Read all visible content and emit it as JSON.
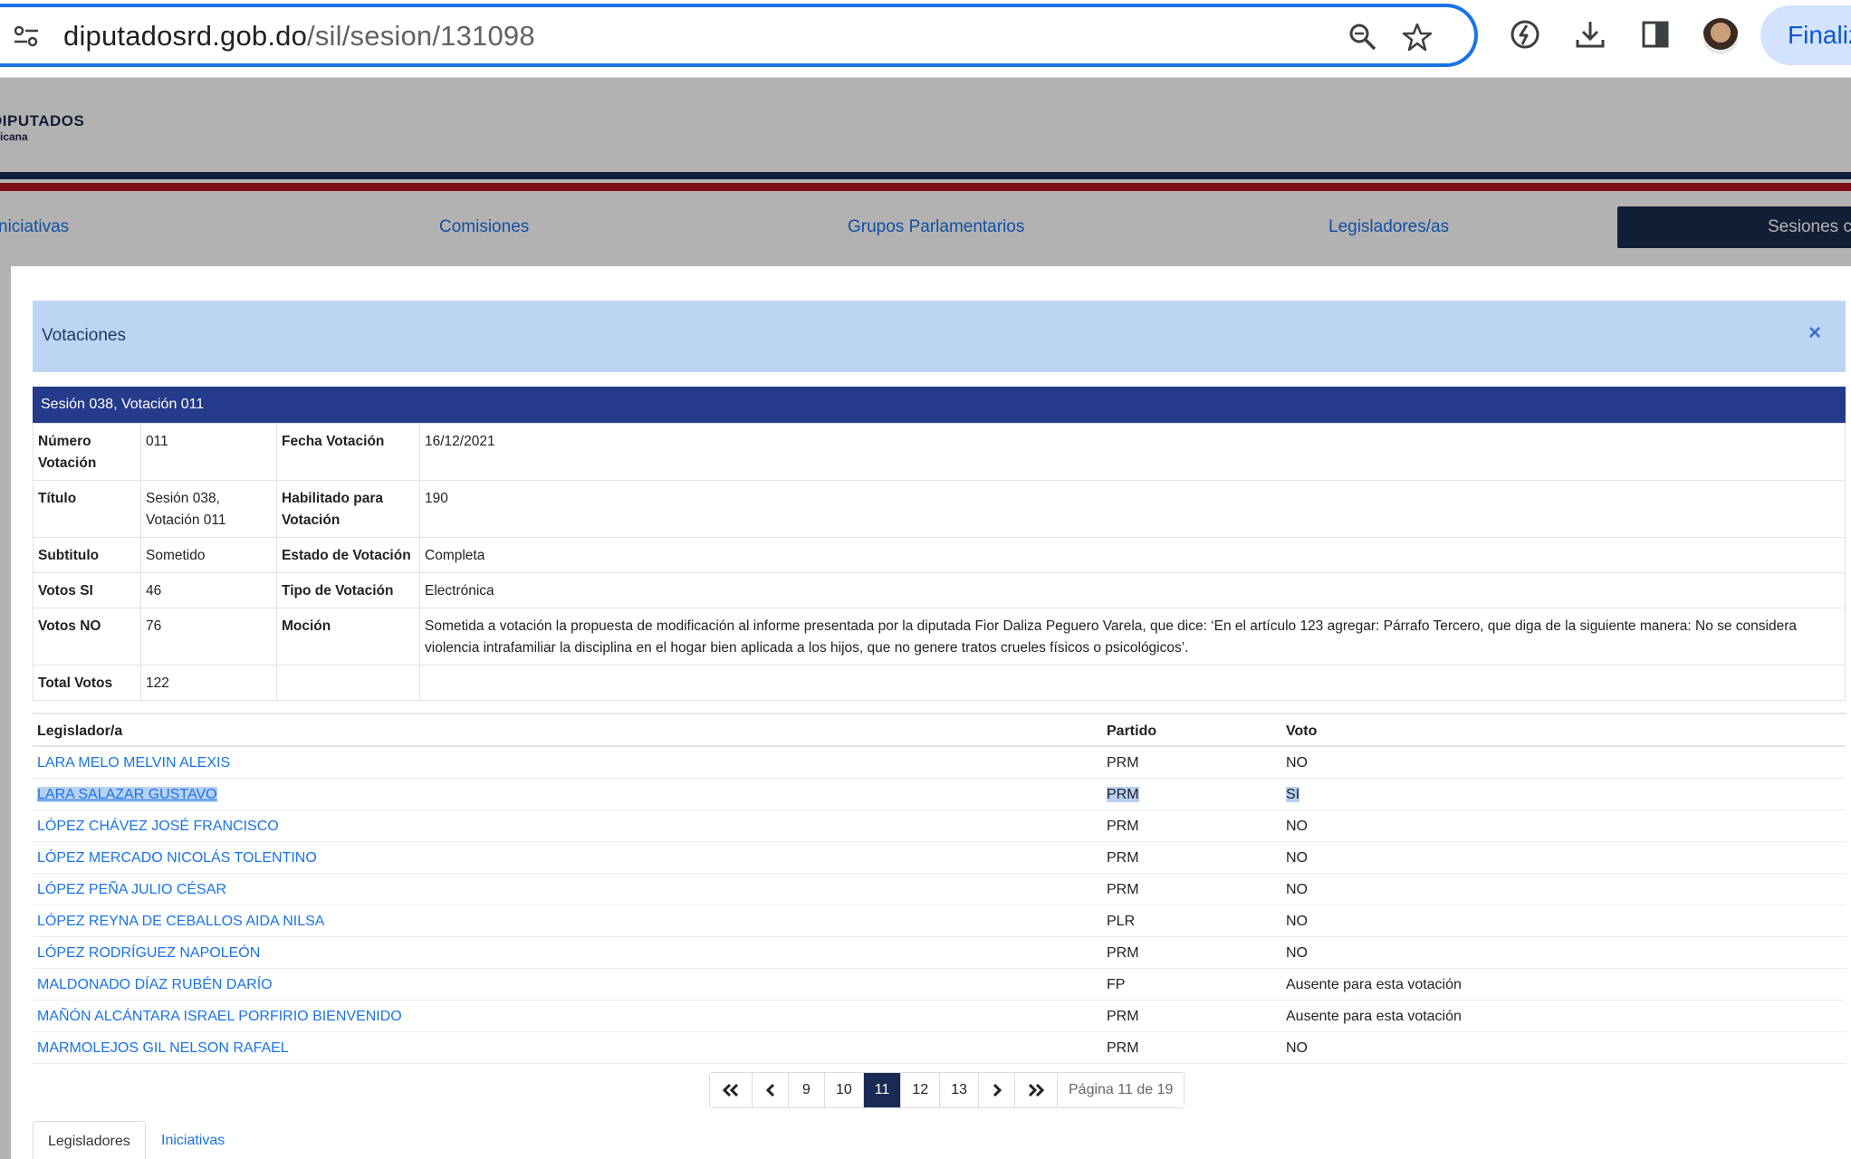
{
  "browser": {
    "url_host": "diputadosrd.gob.do",
    "url_path": "/sil/sesion/131098",
    "finalize_label": "Finaliz"
  },
  "site": {
    "logo_text": "DIPUTADOS",
    "logo_sub": "icana",
    "nav": [
      "niciativas",
      "Comisiones",
      "Grupos Parlamentarios",
      "Legisladores/as"
    ],
    "nav_active": "Sesiones c"
  },
  "modal": {
    "title": "Votaciones",
    "close": "×",
    "detail_header": "Sesión 038, Votación 011",
    "fields": {
      "numero_label": "Número Votación",
      "numero": "011",
      "fecha_label": "Fecha Votación",
      "fecha": "16/12/2021",
      "titulo_label": "Título",
      "titulo": "Sesión 038, Votación 011",
      "habilitado_label": "Habilitado para Votación",
      "habilitado": "190",
      "subtitulo_label": "Subtitulo",
      "subtitulo": "Sometido",
      "estado_label": "Estado de Votación",
      "estado": "Completa",
      "si_label": "Votos SI",
      "si": "46",
      "tipo_label": "Tipo de Votación",
      "tipo": "Electrónica",
      "no_label": "Votos NO",
      "no": "76",
      "mocion_label": "Moción",
      "mocion": "Sometida a votación la propuesta de modificación al informe presentada por la diputada Fior Daliza Peguero Varela, que dice: ‘En el artículo 123 agregar: Párrafo Tercero, que diga de la siguiente manera: No se considera violencia intrafamiliar la disciplina en el hogar bien aplicada a los hijos, que no genere tratos crueles físicos o psicológicos’.",
      "total_label": "Total Votos",
      "total": "122"
    },
    "votes_columns": [
      "Legislador/a",
      "Partido",
      "Voto"
    ],
    "votes": [
      {
        "name": "LARA MELO MELVIN ALEXIS",
        "party": "PRM",
        "vote": "NO"
      },
      {
        "name": "LARA SALAZAR GUSTAVO",
        "party": "PRM",
        "vote": "SI",
        "highlighted": true
      },
      {
        "name": "LÓPEZ CHÁVEZ JOSÉ FRANCISCO",
        "party": "PRM",
        "vote": "NO"
      },
      {
        "name": "LÓPEZ MERCADO NICOLÁS TOLENTINO",
        "party": "PRM",
        "vote": "NO"
      },
      {
        "name": "LÓPEZ PEÑA JULIO CÉSAR",
        "party": "PRM",
        "vote": "NO"
      },
      {
        "name": "LÓPEZ REYNA DE CEBALLOS AIDA NILSA",
        "party": "PLR",
        "vote": "NO"
      },
      {
        "name": "LÓPEZ RODRÍGUEZ NAPOLEÓN",
        "party": "PRM",
        "vote": "NO"
      },
      {
        "name": "MALDONADO DÍAZ RUBÉN DARÍO",
        "party": "FP",
        "vote": "Ausente para esta votación"
      },
      {
        "name": "MAÑÓN ALCÁNTARA ISRAEL PORFIRIO BIENVENIDO",
        "party": "PRM",
        "vote": "Ausente para esta votación"
      },
      {
        "name": "MARMOLEJOS GIL NELSON RAFAEL",
        "party": "PRM",
        "vote": "NO"
      }
    ],
    "pager": {
      "pages": [
        "9",
        "10",
        "11",
        "12",
        "13"
      ],
      "current": "11",
      "info": "Página 11 de 19"
    },
    "tabs": [
      "Legisladores",
      "Iniciativas"
    ]
  },
  "colors": {
    "accent": "#1a73e8",
    "header_bar": "#243a8a",
    "modal_head": "#bcd5f3",
    "pager_active": "#1b2a55"
  }
}
